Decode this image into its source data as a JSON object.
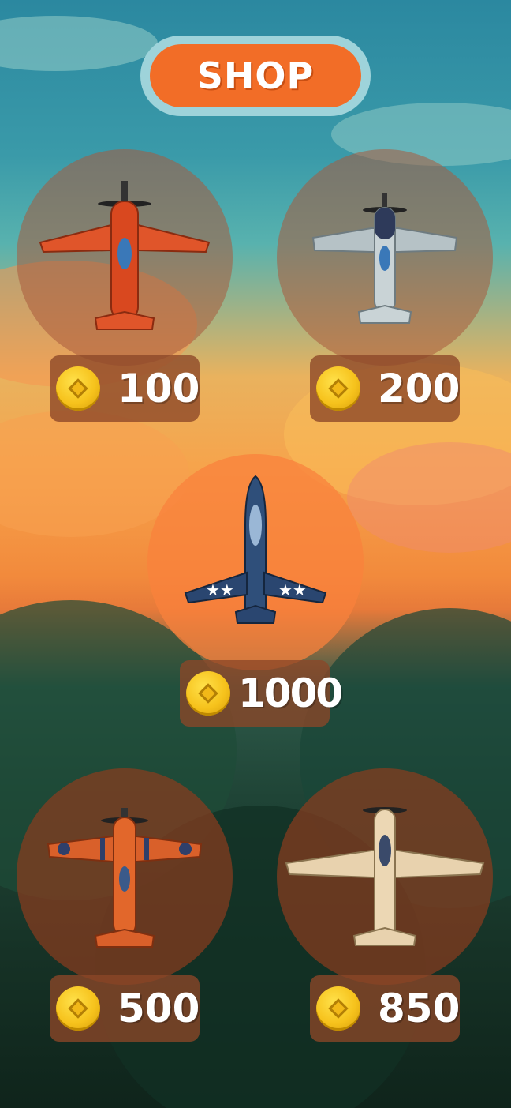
{
  "header": {
    "title": "SHOP"
  },
  "currency_icon": "gold-coin-icon",
  "items": [
    {
      "id": "plane-red",
      "price": "100",
      "plane_colors": {
        "body": "#d9481f",
        "wing": "#e0552a",
        "detail": "#8a2b10"
      }
    },
    {
      "id": "plane-silver",
      "price": "200",
      "plane_colors": {
        "body": "#c9d3d6",
        "wing": "#b6c2c6",
        "detail": "#2e3a5a"
      }
    },
    {
      "id": "plane-jet",
      "price": "1000",
      "plane_colors": {
        "body": "#2f4f7a",
        "wing": "#2a4670",
        "detail": "#9ab7d6"
      }
    },
    {
      "id": "plane-orange",
      "price": "500",
      "plane_colors": {
        "body": "#e2672b",
        "wing": "#d9602a",
        "detail": "#2f3f6a"
      }
    },
    {
      "id": "plane-cream",
      "price": "850",
      "plane_colors": {
        "body": "#ecd7b4",
        "wing": "#e8d2ae",
        "detail": "#3a4a6a"
      }
    }
  ]
}
